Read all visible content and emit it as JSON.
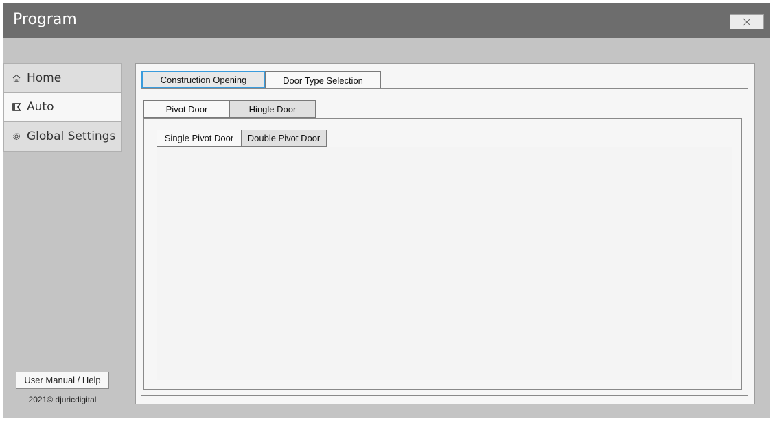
{
  "window": {
    "title": "Program",
    "close_icon": "close-icon"
  },
  "nav": {
    "items": [
      {
        "label": "Home",
        "icon": "home-icon",
        "active": false
      },
      {
        "label": "Auto",
        "icon": "auto-icon",
        "active": true
      },
      {
        "label": "Global Settings",
        "icon": "gear-icon",
        "active": false
      }
    ],
    "help_label": "User Manual / Help",
    "copyright": "2021© djuricdigital"
  },
  "tabs": {
    "level1": [
      {
        "label": "Construction Opening",
        "selected": true
      },
      {
        "label": "Door Type Selection",
        "selected": false
      }
    ],
    "level2": [
      {
        "label": "Pivot Door",
        "selected": true
      },
      {
        "label": "Hingle Door",
        "selected": false
      }
    ],
    "level3": [
      {
        "label": "Single Pivot Door",
        "selected": true
      },
      {
        "label": "Double Pivot Door",
        "selected": false
      }
    ]
  },
  "colors": {
    "titlebar": "#6d6d6d",
    "background": "#c4c4c4",
    "focus_outline": "#3a9bdc"
  }
}
